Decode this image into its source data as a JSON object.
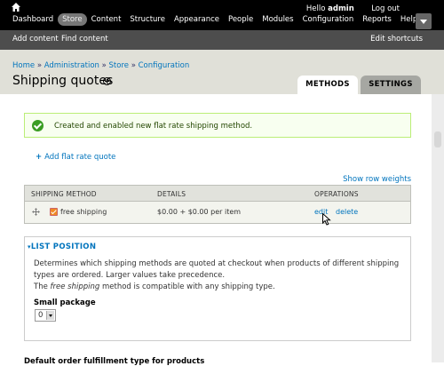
{
  "toolbar": {
    "menu": [
      "Dashboard",
      "Store",
      "Content",
      "Structure",
      "Appearance",
      "People",
      "Modules",
      "Configuration",
      "Reports",
      "Help"
    ],
    "hello": "Hello",
    "username": "admin",
    "logout": "Log out"
  },
  "shortcuts": {
    "add_content": "Add content",
    "find_content": "Find content",
    "edit_shortcuts": "Edit shortcuts"
  },
  "breadcrumb": [
    "Home",
    "Administration",
    "Store",
    "Configuration"
  ],
  "breadcrumb_sep": "»",
  "page_title": "Shipping quotes",
  "tabs": {
    "methods": "METHODS",
    "settings": "SETTINGS"
  },
  "message": "Created and enabled new flat rate shipping method.",
  "add_quote": "Add flat rate quote",
  "show_row_weights": "Show row weights",
  "table": {
    "headers": [
      "SHIPPING METHOD",
      "DETAILS",
      "OPERATIONS"
    ],
    "rows": [
      {
        "method": "free shipping",
        "details": "$0.00 + $0.00 per item",
        "edit": "edit",
        "delete": "delete"
      }
    ]
  },
  "list_position": {
    "legend": "LIST POSITION",
    "description": "Determines which shipping methods are quoted at checkout when products of different shipping types are ordered. Larger values take precedence.",
    "compat_prefix": "The",
    "compat_method": "free shipping",
    "compat_suffix": "method is compatible with any shipping type.",
    "package_label": "Small package",
    "package_value": "0"
  },
  "next_section": "Default order fulfillment type for products",
  "colors": {
    "link": "#0074bd",
    "toolbar": "#000000",
    "shortcuts": "#4d4d4d",
    "success_bg": "#f8fff0"
  }
}
